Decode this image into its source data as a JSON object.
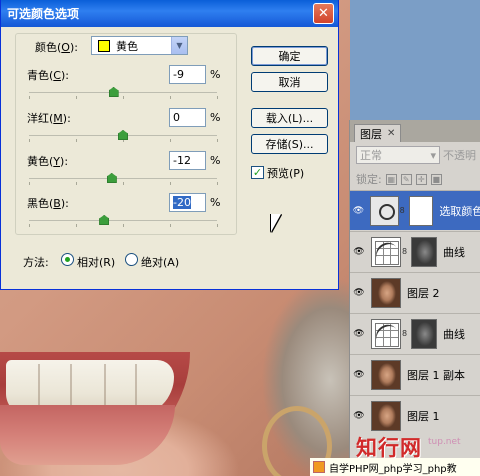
{
  "dialog": {
    "title": "可选颜色选项",
    "colors_label": "颜色(",
    "colors_key": "O",
    "colors_suffix": "):",
    "colors_value": "黄色",
    "swatch_color": "#ffff00",
    "sliders": [
      {
        "label": "青色(",
        "key": "C",
        "suffix": "):",
        "value": "-9",
        "unit": "%",
        "level_percent": 45
      },
      {
        "label": "洋红(",
        "key": "M",
        "suffix": "):",
        "value": "0",
        "unit": "%",
        "level_percent": 50
      },
      {
        "label": "黄色(",
        "key": "Y",
        "suffix": "):",
        "value": "-12",
        "unit": "%",
        "level_percent": 44
      },
      {
        "label": "黑色(",
        "key": "B",
        "suffix": "):",
        "value": "-20",
        "unit": "%",
        "level_percent": 40
      }
    ],
    "buttons": {
      "ok": "确定",
      "cancel": "取消",
      "load": "载入(L)...",
      "save": "存储(S)..."
    },
    "preview": {
      "label": "预览(P)",
      "checked": true
    },
    "method": {
      "label": "方法:",
      "options": [
        "相对(R)",
        "绝对(A)"
      ],
      "selected": "相对(R)"
    }
  },
  "layers_panel": {
    "tab": "图层",
    "blend_mode": "正常",
    "opacity_label": "不透明",
    "lock_label": "锁定:",
    "layers": [
      {
        "name": "选取颜色",
        "type": "selective-color",
        "active": true
      },
      {
        "name": "曲线",
        "type": "curves",
        "active": false
      },
      {
        "name": "图层 2",
        "type": "image",
        "active": false
      },
      {
        "name": "曲线",
        "type": "curves",
        "active": false
      },
      {
        "name": "图层 1 副本",
        "type": "image",
        "active": false
      },
      {
        "name": "图层 1",
        "type": "image",
        "active": false
      }
    ]
  },
  "watermark": {
    "text": "知行网",
    "sub": "tup.net"
  },
  "footer": {
    "text": "自学PHP网_php学习_php教"
  }
}
